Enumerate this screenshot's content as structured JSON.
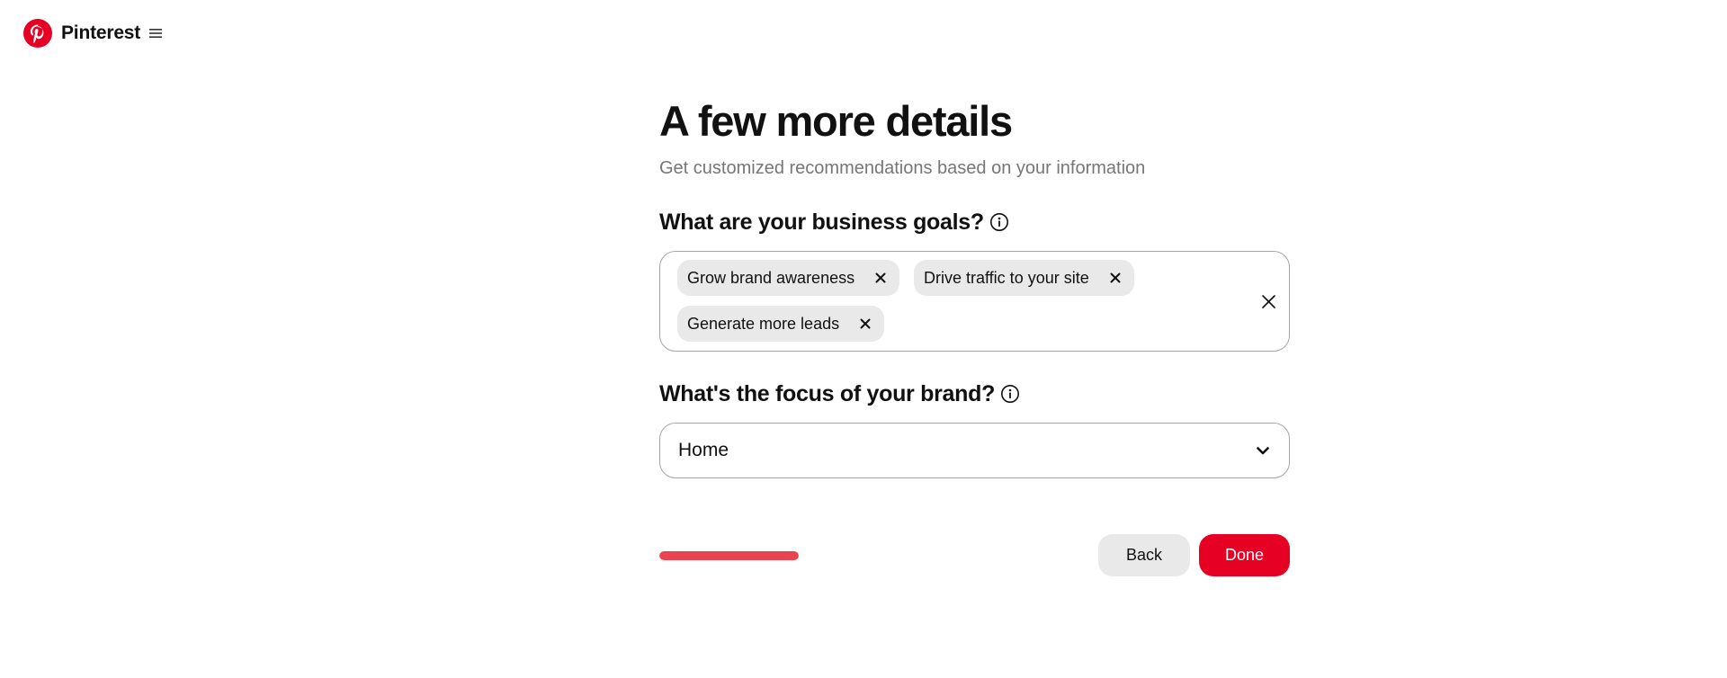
{
  "header": {
    "brand": "Pinterest",
    "logo_icon": "pinterest-logo-icon",
    "menu_icon": "hamburger-menu-icon",
    "brand_color": "#e60023"
  },
  "main": {
    "title": "A few more details",
    "subtitle": "Get customized recommendations based on your information",
    "goals": {
      "label": "What are your business goals?",
      "selected": [
        "Grow brand awareness",
        "Drive traffic to your site",
        "Generate more leads"
      ]
    },
    "focus": {
      "label": "What's the focus of your brand?",
      "value": "Home"
    }
  },
  "footer": {
    "progress_fraction": 1.0,
    "progress_color": "#e9444f",
    "back_label": "Back",
    "done_label": "Done"
  }
}
